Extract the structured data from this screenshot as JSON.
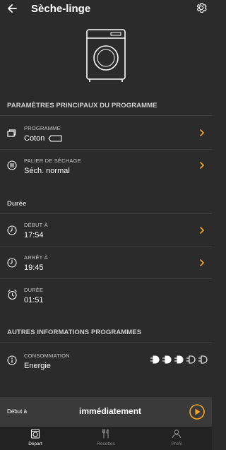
{
  "header": {
    "title": "Sèche-linge",
    "back_icon": "arrow-left-icon",
    "settings_icon": "gear-icon"
  },
  "colors": {
    "accent": "#f5a623",
    "background": "#2b2b2b",
    "bottom_bar": "#3a3a3a",
    "nav": "#222222"
  },
  "sections": {
    "main_params": "PARAMÈTRES PRINCIPAUX DU PROGRAMME",
    "duration": "Durée",
    "other_info": "AUTRES INFORMATIONS PROGRAMMES"
  },
  "program": {
    "label": "PROGRAMME",
    "value": "Coton"
  },
  "drying": {
    "label": "PALIER DE SÉCHAGE",
    "value": "Séch. normal"
  },
  "start": {
    "label": "DÉBUT À",
    "value": "17:54"
  },
  "stop": {
    "label": "ARRÊT À",
    "value": "19:45"
  },
  "duration": {
    "label": "DURÉE",
    "value": "01:51"
  },
  "consumption": {
    "label": "CONSOMMATION",
    "value": "Energie",
    "level_filled": 3,
    "level_total": 5
  },
  "bottom": {
    "start_label": "Début à",
    "start_value": "immédiatement"
  },
  "nav": {
    "items": [
      {
        "label": "Départ",
        "icon": "washer-icon",
        "active": true
      },
      {
        "label": "Recettes",
        "icon": "cutlery-icon",
        "active": false
      },
      {
        "label": "Profil",
        "icon": "person-icon",
        "active": false
      }
    ]
  }
}
